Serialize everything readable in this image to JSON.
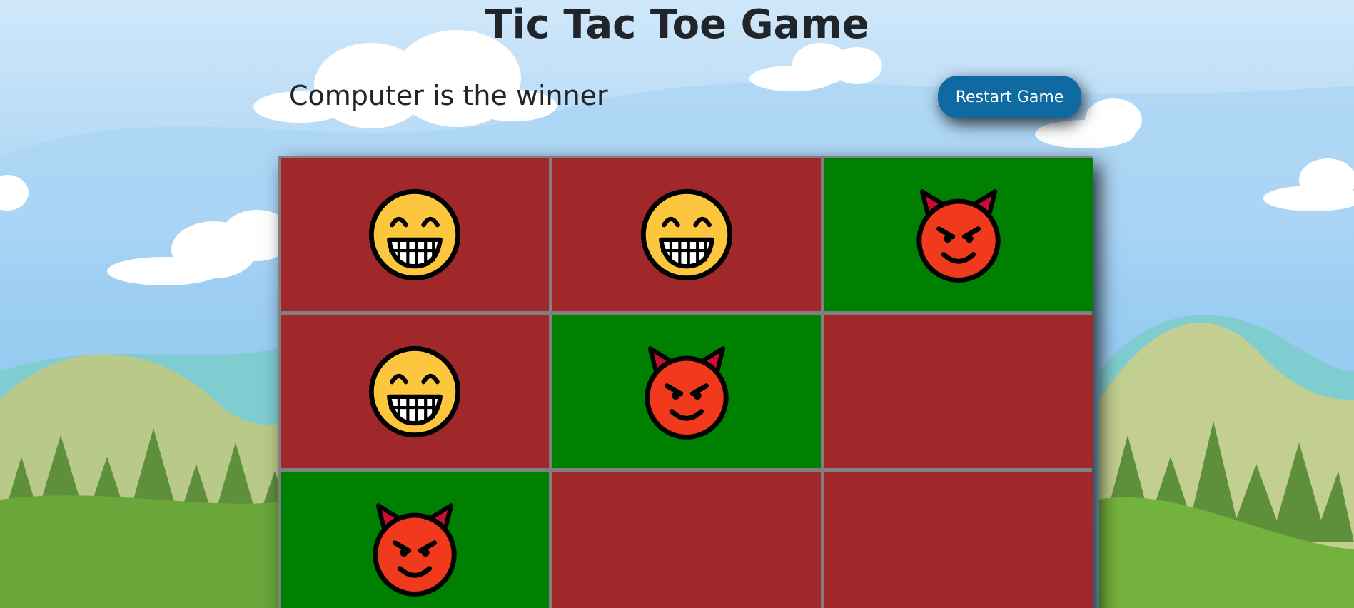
{
  "title": "Tic Tac Toe Game",
  "status": "Computer is the winner",
  "restart_button": "Restart Game",
  "colors": {
    "win_cell": "#008000",
    "lose_cell": "#a0282a",
    "grid": "#808080",
    "button": "#0e6aa0"
  },
  "board": {
    "cells": [
      {
        "mark": "player",
        "icon": "grinning-face-icon",
        "winning": false
      },
      {
        "mark": "player",
        "icon": "grinning-face-icon",
        "winning": false
      },
      {
        "mark": "computer",
        "icon": "devil-face-icon",
        "winning": true
      },
      {
        "mark": "player",
        "icon": "grinning-face-icon",
        "winning": false
      },
      {
        "mark": "computer",
        "icon": "devil-face-icon",
        "winning": true
      },
      {
        "mark": "empty",
        "icon": "",
        "winning": false
      },
      {
        "mark": "computer",
        "icon": "devil-face-icon",
        "winning": true
      },
      {
        "mark": "empty",
        "icon": "",
        "winning": false
      },
      {
        "mark": "empty",
        "icon": "",
        "winning": false
      }
    ]
  }
}
